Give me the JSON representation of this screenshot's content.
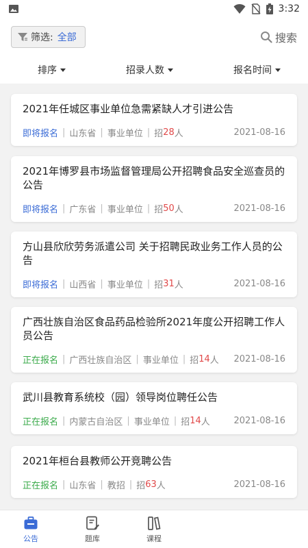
{
  "status_bar": {
    "time": "3:32",
    "left_icon": "image-icon",
    "right_icons": [
      "wifi-icon",
      "no-sim-icon",
      "battery-charging-icon"
    ]
  },
  "header": {
    "filter_label": "筛选:",
    "filter_value": "全部",
    "search_label": "搜索"
  },
  "sort_bar": {
    "items": [
      "排序",
      "招录人数",
      "报名时间"
    ]
  },
  "colors": {
    "accent": "#3a6bd6",
    "open_status": "#3aaa4a",
    "count": "#e04848"
  },
  "announcements": [
    {
      "title": "2021年任城区事业单位急需紧缺人才引进公告",
      "status": "即将报名",
      "region": "山东省",
      "category": "事业单位",
      "recruit_prefix": "招",
      "recruit_count": "28",
      "recruit_suffix": "人",
      "date": "2021-08-16"
    },
    {
      "title": "2021年博罗县市场监督管理局公开招聘食品安全巡查员的公告",
      "status": "即将报名",
      "region": "广东省",
      "category": "事业单位",
      "recruit_prefix": "招",
      "recruit_count": "50",
      "recruit_suffix": "人",
      "date": "2021-08-16"
    },
    {
      "title": "方山县欣欣劳务派遣公司 关于招聘民政业务工作人员的公告",
      "status": "即将报名",
      "region": "山西省",
      "category": "事业单位",
      "recruit_prefix": "招",
      "recruit_count": "31",
      "recruit_suffix": "人",
      "date": "2021-08-16"
    },
    {
      "title": "广西壮族自治区食品药品检验所2021年度公开招聘工作人员公告",
      "status": "正在报名",
      "region": "广西壮族自治区",
      "category": "事业单位",
      "recruit_prefix": "招",
      "recruit_count": "14",
      "recruit_suffix": "人",
      "date": "2021-08-16"
    },
    {
      "title": "武川县教育系统校（园）领导岗位聘任公告",
      "status": "正在报名",
      "region": "内蒙古自治区",
      "category": "事业单位",
      "recruit_prefix": "招",
      "recruit_count": "14",
      "recruit_suffix": "人",
      "date": "2021-08-16"
    },
    {
      "title": "2021年桓台县教师公开竞聘公告",
      "status": "正在报名",
      "region": "山东省",
      "category": "教招",
      "recruit_prefix": "招",
      "recruit_count": "63",
      "recruit_suffix": "人",
      "date": "2021-08-16"
    }
  ],
  "bottom_nav": {
    "items": [
      {
        "label": "公告",
        "icon": "briefcase-icon",
        "active": true
      },
      {
        "label": "题库",
        "icon": "document-edit-icon",
        "active": false
      },
      {
        "label": "课程",
        "icon": "books-icon",
        "active": false
      }
    ]
  }
}
